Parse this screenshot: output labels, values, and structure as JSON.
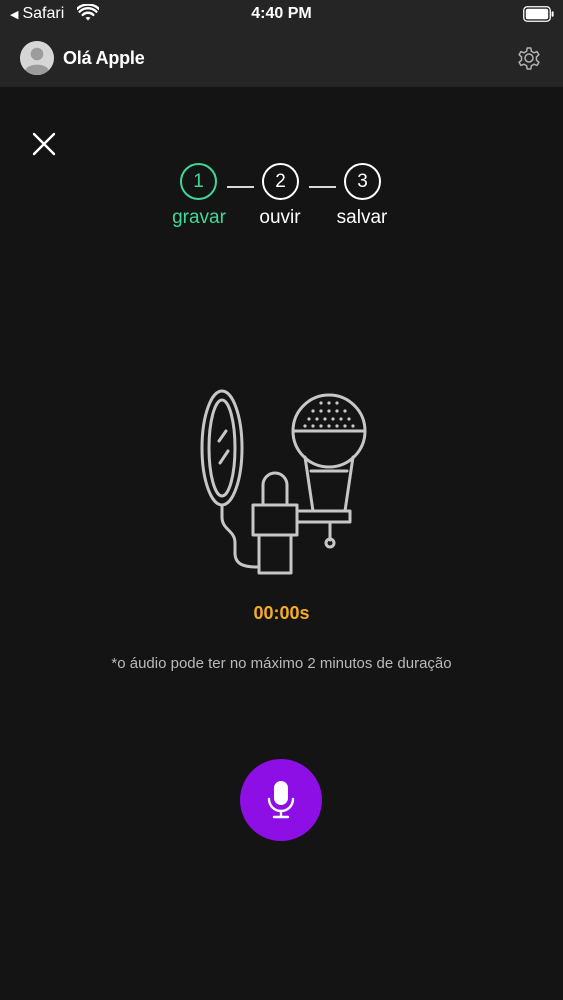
{
  "status_bar": {
    "back_app": "Safari",
    "time": "4:40 PM"
  },
  "header": {
    "greeting": "Olá Apple"
  },
  "stepper": {
    "steps": [
      {
        "number": "1",
        "label": "gravar",
        "active": true
      },
      {
        "number": "2",
        "label": "ouvir",
        "active": false
      },
      {
        "number": "3",
        "label": "salvar",
        "active": false
      }
    ]
  },
  "recorder": {
    "timer": "00:00s",
    "note": "*o áudio pode ter no máximo 2 minutos de duração"
  },
  "colors": {
    "background": "#141414",
    "header": "#252525",
    "active_step": "#3fd89a",
    "timer": "#f4ab27",
    "record_button": "#8d0fe6"
  },
  "icons": {
    "close": "close-icon",
    "settings": "gear-icon",
    "record": "microphone-icon",
    "avatar": "user-avatar-icon"
  }
}
